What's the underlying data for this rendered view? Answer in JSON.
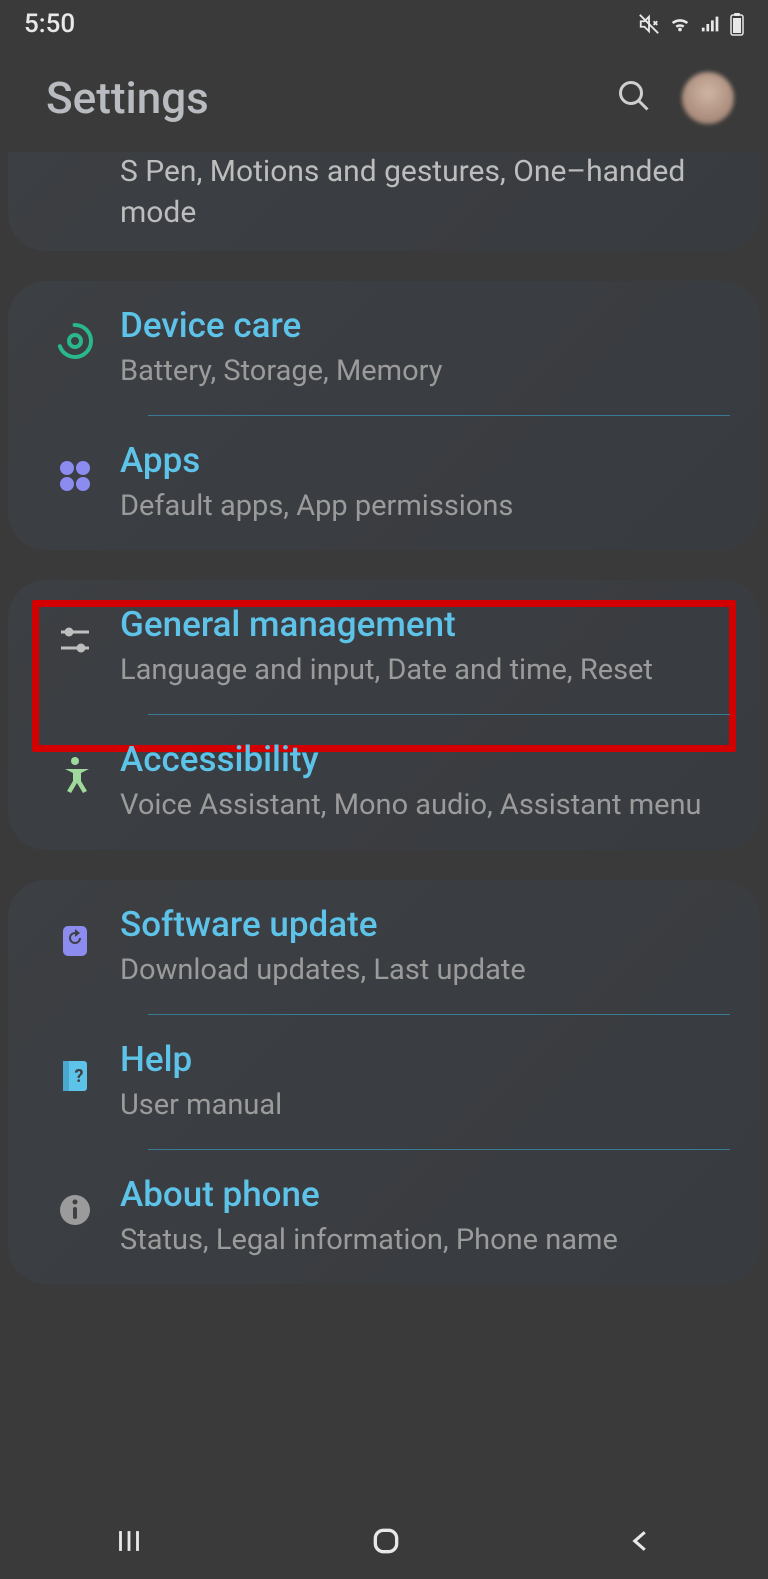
{
  "status": {
    "time": "5:50"
  },
  "header": {
    "title": "Settings"
  },
  "partial": {
    "subtitle": "S Pen, Motions and gestures, One–handed mode"
  },
  "groups": [
    {
      "items": [
        {
          "icon": "device-care",
          "title": "Device care",
          "subtitle": "Battery, Storage, Memory"
        },
        {
          "icon": "apps",
          "title": "Apps",
          "subtitle": "Default apps, App permissions"
        }
      ]
    },
    {
      "items": [
        {
          "icon": "general",
          "title": "General management",
          "subtitle": "Language and input, Date and time, Reset",
          "highlighted": true
        },
        {
          "icon": "accessibility",
          "title": "Accessibility",
          "subtitle": "Voice Assistant, Mono audio, Assistant menu"
        }
      ]
    },
    {
      "items": [
        {
          "icon": "software-update",
          "title": "Software update",
          "subtitle": "Download updates, Last update"
        },
        {
          "icon": "help",
          "title": "Help",
          "subtitle": "User manual"
        },
        {
          "icon": "about",
          "title": "About phone",
          "subtitle": "Status, Legal information, Phone name"
        }
      ]
    }
  ]
}
